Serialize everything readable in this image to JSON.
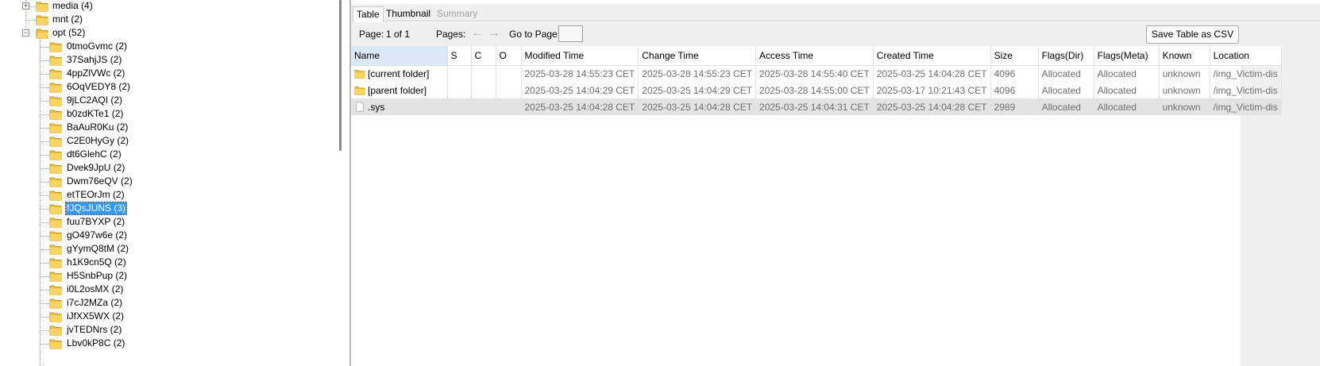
{
  "tree": {
    "top_nodes": [
      {
        "label": "media (4)",
        "expanded": false
      },
      {
        "label": "mnt (2)",
        "expanded": null
      },
      {
        "label": "opt (52)",
        "expanded": true
      }
    ],
    "children": [
      "0tmoGvmc (2)",
      "37SahjJS (2)",
      "4ppZlVWc (2)",
      "6OqVEDY8 (2)",
      "9jLC2AQI (2)",
      "b0zdKTe1 (2)",
      "BaAuR0Ku (2)",
      "C2E0HyGy (2)",
      "dt6GlehC (2)",
      "Dvek9JpU (2)",
      "Dwm76eQV (2)",
      "etTEOrJm (2)",
      "fJQsJUNS (3)",
      "fuu7BYXP (2)",
      "gO497w6e (2)",
      "gYymQ8tM (2)",
      "h1K9cn5Q (2)",
      "H5SnbPup (2)",
      "i0L2osMX (2)",
      "i7cJ2MZa (2)",
      "iJfXX5WX (2)",
      "jvTEDNrs (2)",
      "Lbv0kP8C (2)"
    ],
    "selected_index": 12
  },
  "tabs": [
    {
      "label": "Table",
      "state": "active"
    },
    {
      "label": "Thumbnail",
      "state": "normal"
    },
    {
      "label": "Summary",
      "state": "disabled"
    }
  ],
  "pagebar": {
    "page_label": "Page:",
    "page_value": "1 of 1",
    "pages_label": "Pages:",
    "goto_label": "Go to Page:",
    "save_csv_label": "Save Table as CSV"
  },
  "table": {
    "columns": [
      "Name",
      "S",
      "C",
      "O",
      "Modified Time",
      "Change Time",
      "Access Time",
      "Created Time",
      "Size",
      "Flags(Dir)",
      "Flags(Meta)",
      "Known",
      "Location"
    ],
    "rows": [
      {
        "icon": "folder-icon",
        "cells": [
          "[current folder]",
          "",
          "",
          "",
          "2025-03-28 14:55:23 CET",
          "2025-03-28 14:55:23 CET",
          "2025-03-28 14:55:40 CET",
          "2025-03-25 14:04:28 CET",
          "4096",
          "Allocated",
          "Allocated",
          "unknown",
          "/img_Victim-dis"
        ]
      },
      {
        "icon": "folder-icon",
        "cells": [
          "[parent folder]",
          "",
          "",
          "",
          "2025-03-25 14:04:29 CET",
          "2025-03-25 14:04:29 CET",
          "2025-03-28 14:55:00 CET",
          "2025-03-17 10:21:43 CET",
          "4096",
          "Allocated",
          "Allocated",
          "unknown",
          "/img_Victim-dis"
        ]
      },
      {
        "icon": "file-icon",
        "cells": [
          ".sys",
          "",
          "",
          "",
          "2025-03-25 14:04:28 CET",
          "2025-03-25 14:04:28 CET",
          "2025-03-25 14:04:31 CET",
          "2025-03-25 14:04:28 CET",
          "2989",
          "Allocated",
          "Allocated",
          "unknown",
          "/img_Victim-dis"
        ]
      }
    ],
    "selected_row": 2
  }
}
